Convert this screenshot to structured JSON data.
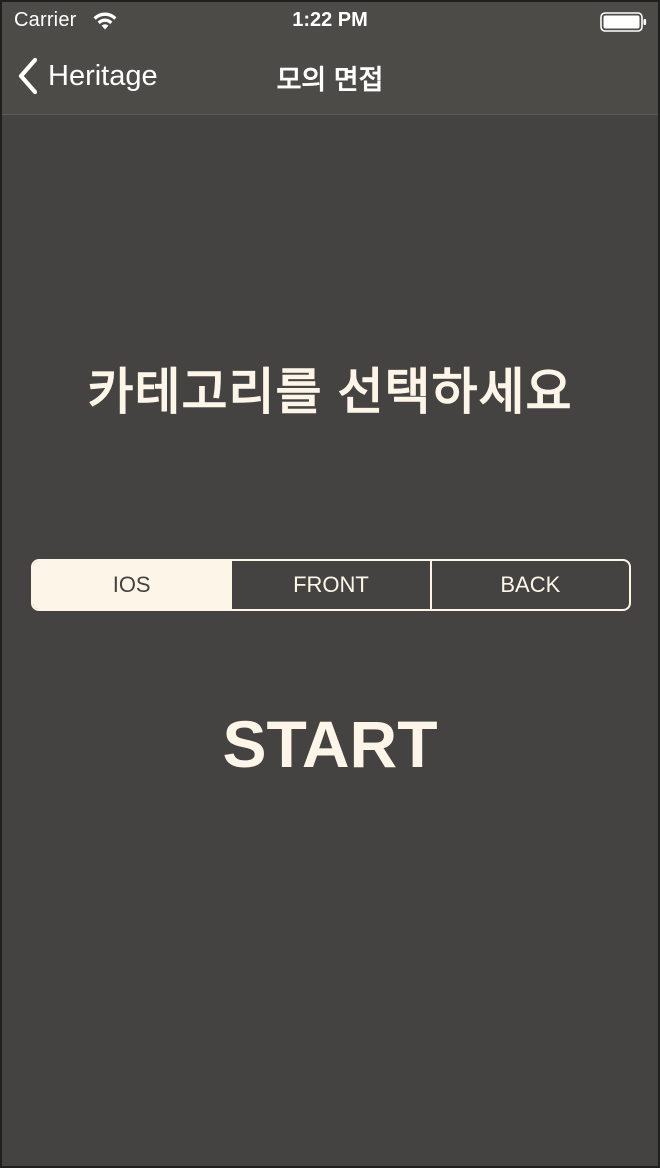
{
  "status_bar": {
    "carrier": "Carrier",
    "time": "1:22 PM"
  },
  "nav": {
    "back_label": "Heritage",
    "title": "모의 면접"
  },
  "main": {
    "heading": "카테고리를 선택하세요",
    "segments": [
      {
        "label": "IOS",
        "selected": true
      },
      {
        "label": "FRONT",
        "selected": false
      },
      {
        "label": "BACK",
        "selected": false
      }
    ],
    "start_label": "START"
  },
  "colors": {
    "background": "#454341",
    "navbar": "#4d4b48",
    "accent_cream": "#fdf6e8"
  },
  "icons": {
    "wifi": "wifi-icon",
    "battery": "battery-icon",
    "back": "chevron-left-icon"
  }
}
